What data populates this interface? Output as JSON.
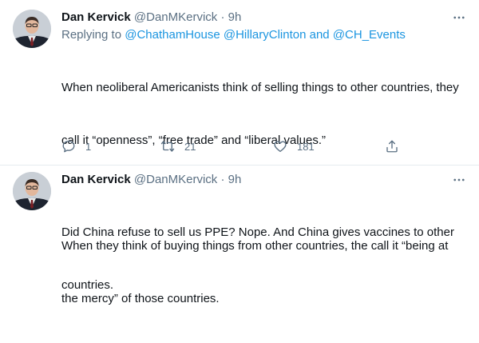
{
  "tweets": [
    {
      "author_name": "Dan Kervick",
      "handle": "@DanMKervick",
      "separator": "·",
      "time": "9h",
      "replying_prefix": "Replying to",
      "replying_to": [
        "@ChathamHouse",
        "@HillaryClinton"
      ],
      "replying_and": "and",
      "replying_last": "@CH_Events",
      "body_lines": [
        "When neoliberal Americanists think of selling things to other countries, they",
        "call it “openness”, “free trade” and “liberal values.”",
        "When they think of buying things from other countries, the call it “being at",
        "the mercy” of those countries."
      ],
      "reply_count": "1",
      "retweet_count": "21",
      "like_count": "181"
    },
    {
      "author_name": "Dan Kervick",
      "handle": "@DanMKervick",
      "separator": "·",
      "time": "9h",
      "body_lines": [
        "Did China refuse to sell us PPE? Nope. And China gives vaccines to other",
        "countries."
      ]
    }
  ],
  "icons": {
    "more": "more-options-icon",
    "reply": "reply-icon",
    "retweet": "retweet-icon",
    "like": "heart-icon",
    "share": "share-icon"
  },
  "colors": {
    "text": "#0f1419",
    "secondary": "#5b7083",
    "link": "#1b95e0",
    "divider": "#e6ecf0"
  }
}
